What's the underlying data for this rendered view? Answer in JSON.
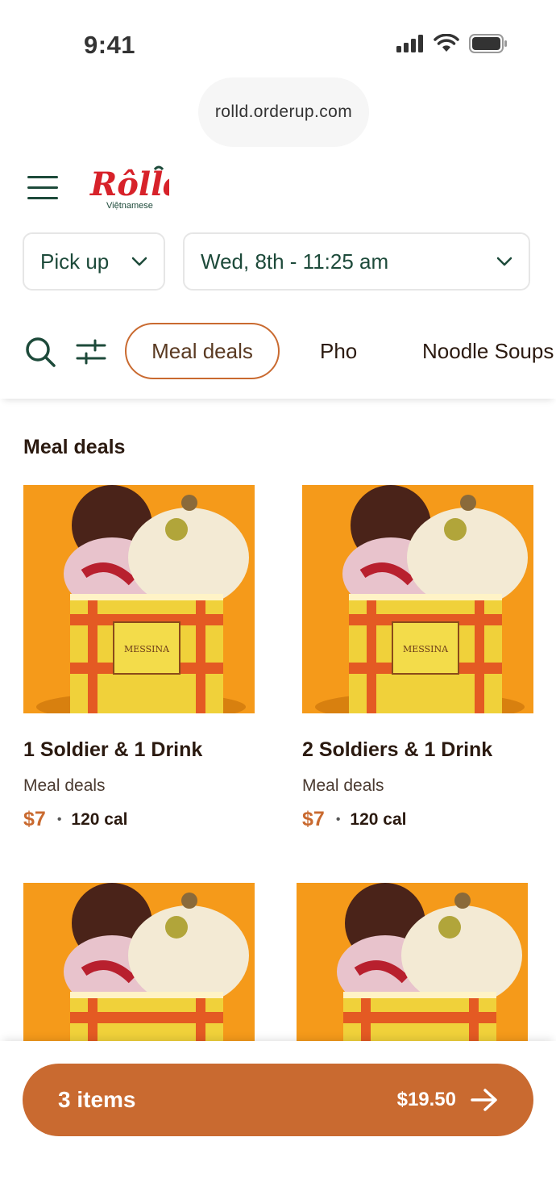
{
  "status_bar": {
    "time": "9:41"
  },
  "browser": {
    "url": "rolld.orderup.com"
  },
  "header": {
    "logo_name": "Rolld",
    "logo_sub": "Việtnamese"
  },
  "selectors": {
    "fulfillment": "Pick up",
    "datetime": "Wed, 8th - 11:25 am"
  },
  "categories": [
    {
      "label": "Meal deals",
      "active": true
    },
    {
      "label": "Pho",
      "active": false
    },
    {
      "label": "Noodle Soups",
      "active": false
    }
  ],
  "section": {
    "title": "Meal deals"
  },
  "items": [
    {
      "name": "1 Soldier & 1 Drink",
      "category": "Meal deals",
      "price": "$7",
      "calories": "120 cal"
    },
    {
      "name": "2 Soldiers & 1 Drink",
      "category": "Meal deals",
      "price": "$7",
      "calories": "120 cal"
    }
  ],
  "image_brand": "MESSINA",
  "cart": {
    "count_label": "3 items",
    "total": "$19.50"
  },
  "colors": {
    "accent": "#c96a30",
    "brand_green": "#1d4a3a",
    "brand_red": "#d7222a"
  }
}
